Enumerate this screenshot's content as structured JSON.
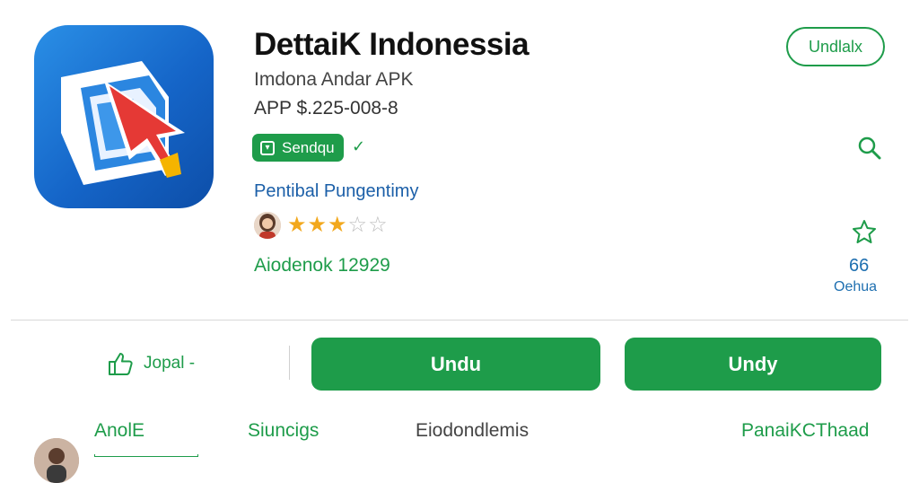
{
  "app": {
    "title": "DettaiK Indonessia",
    "subtitle": "Imdona Andar APK",
    "meta": "APP $.225-008-8",
    "badge_label": "Sendqu",
    "verified_mark": "✓",
    "developer": "Pentibal Pungentimy",
    "rating": {
      "value": 3,
      "max": 5
    },
    "downloads_text": "Aiodenok 12929"
  },
  "header": {
    "install_outline_label": "Undlalx"
  },
  "sidebar_stats": {
    "count_value": "66",
    "count_label": "Oehua"
  },
  "actions": {
    "like_label": "Jopal -",
    "primary_button": "Undu",
    "secondary_button": "Undy"
  },
  "tabs": [
    {
      "label": "AnolE"
    },
    {
      "label": "Siuncigs"
    },
    {
      "label": "Eiodondlemis"
    },
    {
      "label": "PanaiKCThaad"
    }
  ],
  "colors": {
    "accent_green": "#1e9c4a",
    "link_blue": "#1b5fa8",
    "star_gold": "#f2a81d",
    "icon_blue": "#1565c8"
  },
  "icons": {
    "app_icon": "document-cursor-icon",
    "search": "search-icon",
    "wishlist": "star-outline-icon",
    "like": "thumbs-up-icon",
    "badge": "shield-icon"
  }
}
